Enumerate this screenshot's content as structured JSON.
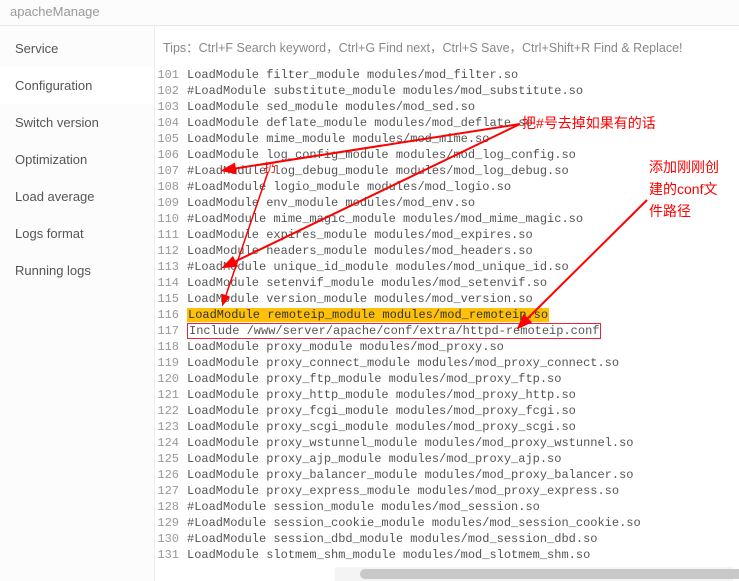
{
  "header": {
    "title": "apacheManage"
  },
  "sidebar": {
    "items": [
      {
        "label": "Service"
      },
      {
        "label": "Configuration"
      },
      {
        "label": "Switch version"
      },
      {
        "label": "Optimization"
      },
      {
        "label": "Load average"
      },
      {
        "label": "Logs format"
      },
      {
        "label": "Running logs"
      }
    ]
  },
  "tips": "Tips：Ctrl+F Search keyword，Ctrl+G Find next，Ctrl+S Save，Ctrl+Shift+R Find & Replace!",
  "lines": [
    {
      "n": 101,
      "t": "LoadModule filter_module modules/mod_filter.so"
    },
    {
      "n": 102,
      "t": "#LoadModule substitute_module modules/mod_substitute.so"
    },
    {
      "n": 103,
      "t": "LoadModule sed_module modules/mod_sed.so"
    },
    {
      "n": 104,
      "t": "LoadModule deflate_module modules/mod_deflate.so"
    },
    {
      "n": 105,
      "t": "LoadModule mime_module modules/mod_mime.so"
    },
    {
      "n": 106,
      "t": "LoadModule log_config_module modules/mod_log_config.so"
    },
    {
      "n": 107,
      "t": "#LoadModule log_debug_module modules/mod_log_debug.so"
    },
    {
      "n": 108,
      "t": "#LoadModule logio_module modules/mod_logio.so"
    },
    {
      "n": 109,
      "t": "LoadModule env_module modules/mod_env.so"
    },
    {
      "n": 110,
      "t": "#LoadModule mime_magic_module modules/mod_mime_magic.so"
    },
    {
      "n": 111,
      "t": "LoadModule expires_module modules/mod_expires.so"
    },
    {
      "n": 112,
      "t": "LoadModule headers_module modules/mod_headers.so"
    },
    {
      "n": 113,
      "t": "#LoadModule unique_id_module modules/mod_unique_id.so"
    },
    {
      "n": 114,
      "t": "LoadModule setenvif_module modules/mod_setenvif.so"
    },
    {
      "n": 115,
      "t": "LoadModule version_module modules/mod_version.so"
    },
    {
      "n": 116,
      "t": "LoadModule remoteip_module modules/mod_remoteip.so",
      "hl": "yellow"
    },
    {
      "n": 117,
      "t": "Include /www/server/apache/conf/extra/httpd-remoteip.conf",
      "hl": "box"
    },
    {
      "n": 118,
      "t": "LoadModule proxy_module modules/mod_proxy.so"
    },
    {
      "n": 119,
      "t": "LoadModule proxy_connect_module modules/mod_proxy_connect.so"
    },
    {
      "n": 120,
      "t": "LoadModule proxy_ftp_module modules/mod_proxy_ftp.so"
    },
    {
      "n": 121,
      "t": "LoadModule proxy_http_module modules/mod_proxy_http.so"
    },
    {
      "n": 122,
      "t": "LoadModule proxy_fcgi_module modules/mod_proxy_fcgi.so"
    },
    {
      "n": 123,
      "t": "LoadModule proxy_scgi_module modules/mod_proxy_scgi.so"
    },
    {
      "n": 124,
      "t": "LoadModule proxy_wstunnel_module modules/mod_proxy_wstunnel.so"
    },
    {
      "n": 125,
      "t": "LoadModule proxy_ajp_module modules/mod_proxy_ajp.so"
    },
    {
      "n": 126,
      "t": "LoadModule proxy_balancer_module modules/mod_proxy_balancer.so"
    },
    {
      "n": 127,
      "t": "LoadModule proxy_express_module modules/mod_proxy_express.so"
    },
    {
      "n": 128,
      "t": "#LoadModule session_module modules/mod_session.so"
    },
    {
      "n": 129,
      "t": "#LoadModule session_cookie_module modules/mod_session_cookie.so"
    },
    {
      "n": 130,
      "t": "#LoadModule session_dbd_module modules/mod_session_dbd.so"
    },
    {
      "n": 131,
      "t": "LoadModule slotmem_shm_module modules/mod_slotmem_shm.so"
    }
  ],
  "annotations": {
    "top": "把#号去掉如果有的话",
    "right": "添加刚刚创建的conf文件路径",
    "small": "扔"
  }
}
